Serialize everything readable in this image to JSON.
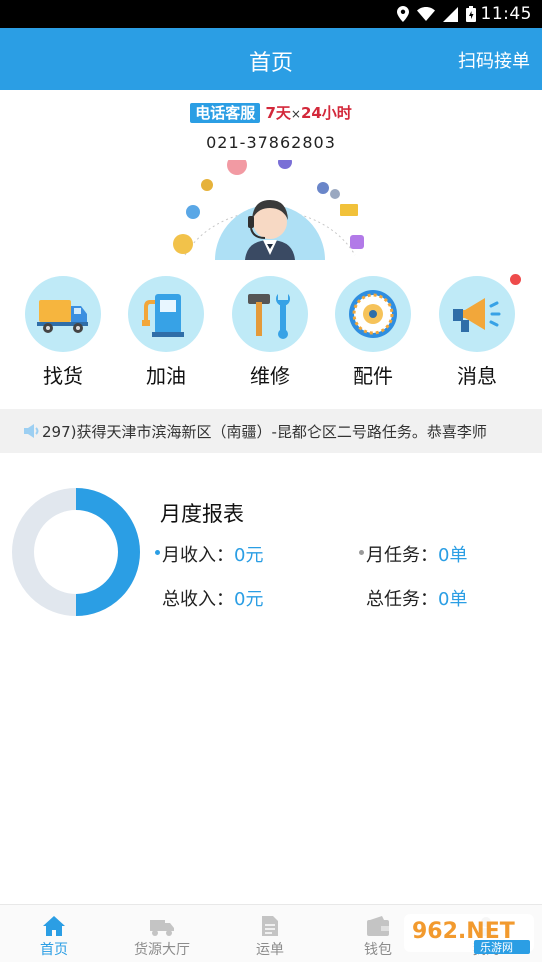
{
  "status_bar": {
    "time": "11:45"
  },
  "header": {
    "title": "首页",
    "scan_label": "扫码接单"
  },
  "service": {
    "badge": "电话客服",
    "days": "7天",
    "times": "×",
    "hours": "24小时",
    "phone": "021-37862803"
  },
  "quick_actions": [
    {
      "label": "找货",
      "icon": "truck-icon"
    },
    {
      "label": "加油",
      "icon": "fuel-pump-icon"
    },
    {
      "label": "维修",
      "icon": "tools-icon"
    },
    {
      "label": "配件",
      "icon": "parts-dial-icon"
    },
    {
      "label": "消息",
      "icon": "megaphone-icon"
    }
  ],
  "ticker": {
    "text": "297)获得天津市滨海新区（南疆）-昆都仑区二号路任务。恭喜李师"
  },
  "report": {
    "title": "月度报表",
    "monthly_income_label": "月收入：",
    "monthly_income_value": "0元",
    "monthly_tasks_label": "月任务：",
    "monthly_tasks_value": "0单",
    "total_income_label": "总收入：",
    "total_income_value": "0元",
    "total_tasks_label": "总任务：",
    "total_tasks_value": "0单",
    "colors": {
      "primary": "#2b9ee4",
      "track": "#e1e7ee"
    }
  },
  "tabs": [
    {
      "label": "首页",
      "icon": "home-icon",
      "active": true
    },
    {
      "label": "货源大厅",
      "icon": "truck-icon",
      "active": false
    },
    {
      "label": "运单",
      "icon": "document-icon",
      "active": false
    },
    {
      "label": "钱包",
      "icon": "wallet-icon",
      "active": false
    },
    {
      "label": "我的",
      "icon": "user-icon",
      "active": false
    }
  ],
  "watermark": {
    "brand": "962.NET",
    "subtitle": "乐游网"
  }
}
